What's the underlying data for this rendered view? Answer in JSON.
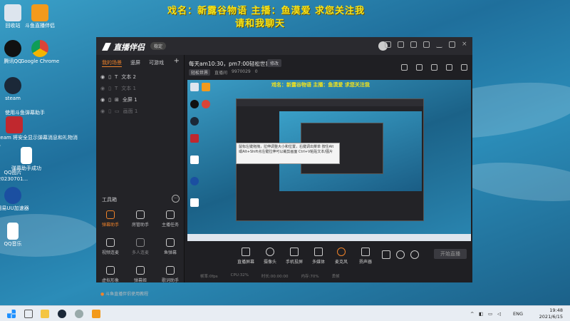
{
  "desktop": {
    "banner_line1": "戏名：新露谷物语  主播：鱼漠爱  求您关注我",
    "banner_line2": "请和我聊天",
    "icons": [
      {
        "label": "回收站"
      },
      {
        "label": "斗鱼直播伴侣"
      },
      {
        "label": "腾讯QQ"
      },
      {
        "label": "Google Chrome"
      },
      {
        "label": "steam"
      },
      {
        "label": "使用斗鱼弹幕助手"
      },
      {
        "label": "steam 将安全显示弹幕消息和礼物消息"
      },
      {
        "label": "弹幕助手成功"
      },
      {
        "label": "QQ图片20230701..."
      },
      {
        "label": "网易UU加速器"
      },
      {
        "label": "QQ音乐"
      }
    ]
  },
  "app": {
    "logo": "直播伴侣",
    "version_badge": "稳定",
    "left_tabs": [
      "我的场景",
      "竖屏",
      "可游戏"
    ],
    "sources": [
      {
        "label": "文本 2",
        "dim": false
      },
      {
        "label": "文本 1",
        "dim": true
      },
      {
        "label": "全屏 1",
        "dim": false
      },
      {
        "label": "画面 1",
        "dim": true
      }
    ],
    "tools_title": "工具箱",
    "tools": [
      {
        "label": "弹幕助手",
        "on": true
      },
      {
        "label": "房管助手",
        "on": false
      },
      {
        "label": "主播任务",
        "on": false
      },
      {
        "label": "视频连麦",
        "on": false
      },
      {
        "label": "多人连麦",
        "on": false
      },
      {
        "label": "鱼弹幕",
        "on": false
      },
      {
        "label": "虚拟形象",
        "on": false
      },
      {
        "label": "弹幕姬",
        "on": false
      },
      {
        "label": "歌词助手",
        "on": false
      },
      {
        "label": "",
        "on": false
      },
      {
        "label": "",
        "on": false
      },
      {
        "label": "",
        "on": false
      }
    ],
    "help_text": "斗鱼直播伴侣使用教程",
    "stream_title": "每天am10:30，pm7:00轻松世界",
    "edit_label": "修改",
    "meta_category": "轻松世界",
    "meta_room": "直播间",
    "meta_room_id": "9970029",
    "meta_count": "0",
    "preview_banner": "戏名：新露谷物语  主播：鱼漠爱  求您关注我",
    "tooltip": "鼠标左键拖拽，拉伸调整大小和位置，右键调出菜单 按住Alt或Alt+Shift点左键拉伸可以裁剪画面 Ctrl+V粘贴文本/图片",
    "controls": [
      "直播屏幕",
      "摄像头",
      "手机投屏",
      "多媒体",
      "麦克风",
      "扬声器"
    ],
    "go_live": "开始直播",
    "status": [
      "帧率:0fps",
      "CPU:32%",
      "时长:00:00:00",
      "内存:70%",
      "丢帧"
    ]
  },
  "taskbar": {
    "lang": "ENG",
    "time": "19:48",
    "date": "2021/6/15"
  }
}
